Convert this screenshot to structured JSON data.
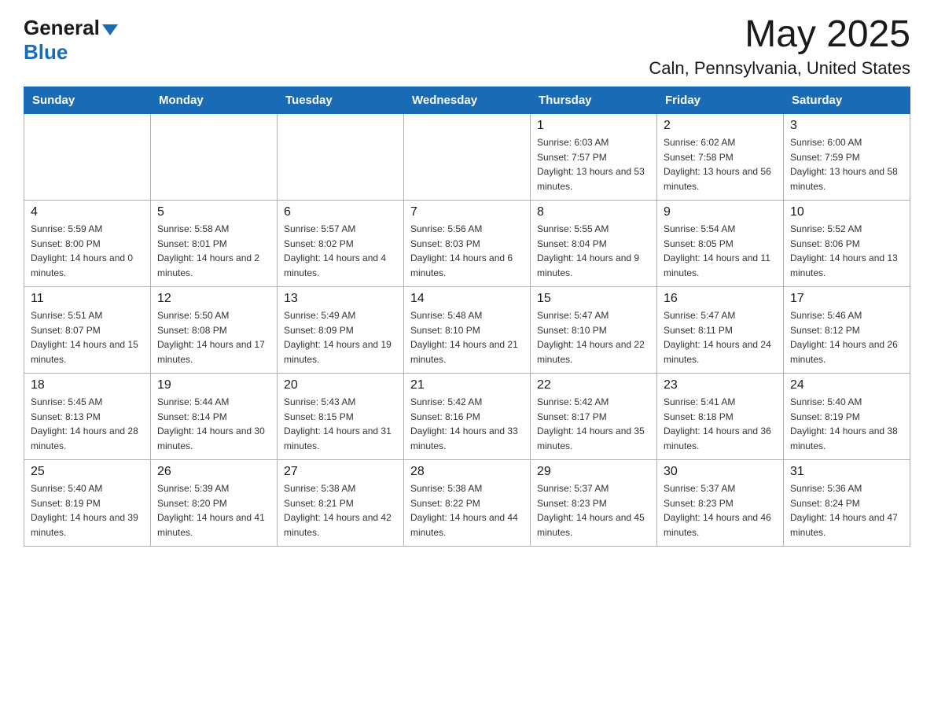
{
  "header": {
    "logo_general": "General",
    "logo_blue": "Blue",
    "month_title": "May 2025",
    "location": "Caln, Pennsylvania, United States"
  },
  "weekdays": [
    "Sunday",
    "Monday",
    "Tuesday",
    "Wednesday",
    "Thursday",
    "Friday",
    "Saturday"
  ],
  "weeks": [
    [
      {
        "day": "",
        "info": ""
      },
      {
        "day": "",
        "info": ""
      },
      {
        "day": "",
        "info": ""
      },
      {
        "day": "",
        "info": ""
      },
      {
        "day": "1",
        "info": "Sunrise: 6:03 AM\nSunset: 7:57 PM\nDaylight: 13 hours and 53 minutes."
      },
      {
        "day": "2",
        "info": "Sunrise: 6:02 AM\nSunset: 7:58 PM\nDaylight: 13 hours and 56 minutes."
      },
      {
        "day": "3",
        "info": "Sunrise: 6:00 AM\nSunset: 7:59 PM\nDaylight: 13 hours and 58 minutes."
      }
    ],
    [
      {
        "day": "4",
        "info": "Sunrise: 5:59 AM\nSunset: 8:00 PM\nDaylight: 14 hours and 0 minutes."
      },
      {
        "day": "5",
        "info": "Sunrise: 5:58 AM\nSunset: 8:01 PM\nDaylight: 14 hours and 2 minutes."
      },
      {
        "day": "6",
        "info": "Sunrise: 5:57 AM\nSunset: 8:02 PM\nDaylight: 14 hours and 4 minutes."
      },
      {
        "day": "7",
        "info": "Sunrise: 5:56 AM\nSunset: 8:03 PM\nDaylight: 14 hours and 6 minutes."
      },
      {
        "day": "8",
        "info": "Sunrise: 5:55 AM\nSunset: 8:04 PM\nDaylight: 14 hours and 9 minutes."
      },
      {
        "day": "9",
        "info": "Sunrise: 5:54 AM\nSunset: 8:05 PM\nDaylight: 14 hours and 11 minutes."
      },
      {
        "day": "10",
        "info": "Sunrise: 5:52 AM\nSunset: 8:06 PM\nDaylight: 14 hours and 13 minutes."
      }
    ],
    [
      {
        "day": "11",
        "info": "Sunrise: 5:51 AM\nSunset: 8:07 PM\nDaylight: 14 hours and 15 minutes."
      },
      {
        "day": "12",
        "info": "Sunrise: 5:50 AM\nSunset: 8:08 PM\nDaylight: 14 hours and 17 minutes."
      },
      {
        "day": "13",
        "info": "Sunrise: 5:49 AM\nSunset: 8:09 PM\nDaylight: 14 hours and 19 minutes."
      },
      {
        "day": "14",
        "info": "Sunrise: 5:48 AM\nSunset: 8:10 PM\nDaylight: 14 hours and 21 minutes."
      },
      {
        "day": "15",
        "info": "Sunrise: 5:47 AM\nSunset: 8:10 PM\nDaylight: 14 hours and 22 minutes."
      },
      {
        "day": "16",
        "info": "Sunrise: 5:47 AM\nSunset: 8:11 PM\nDaylight: 14 hours and 24 minutes."
      },
      {
        "day": "17",
        "info": "Sunrise: 5:46 AM\nSunset: 8:12 PM\nDaylight: 14 hours and 26 minutes."
      }
    ],
    [
      {
        "day": "18",
        "info": "Sunrise: 5:45 AM\nSunset: 8:13 PM\nDaylight: 14 hours and 28 minutes."
      },
      {
        "day": "19",
        "info": "Sunrise: 5:44 AM\nSunset: 8:14 PM\nDaylight: 14 hours and 30 minutes."
      },
      {
        "day": "20",
        "info": "Sunrise: 5:43 AM\nSunset: 8:15 PM\nDaylight: 14 hours and 31 minutes."
      },
      {
        "day": "21",
        "info": "Sunrise: 5:42 AM\nSunset: 8:16 PM\nDaylight: 14 hours and 33 minutes."
      },
      {
        "day": "22",
        "info": "Sunrise: 5:42 AM\nSunset: 8:17 PM\nDaylight: 14 hours and 35 minutes."
      },
      {
        "day": "23",
        "info": "Sunrise: 5:41 AM\nSunset: 8:18 PM\nDaylight: 14 hours and 36 minutes."
      },
      {
        "day": "24",
        "info": "Sunrise: 5:40 AM\nSunset: 8:19 PM\nDaylight: 14 hours and 38 minutes."
      }
    ],
    [
      {
        "day": "25",
        "info": "Sunrise: 5:40 AM\nSunset: 8:19 PM\nDaylight: 14 hours and 39 minutes."
      },
      {
        "day": "26",
        "info": "Sunrise: 5:39 AM\nSunset: 8:20 PM\nDaylight: 14 hours and 41 minutes."
      },
      {
        "day": "27",
        "info": "Sunrise: 5:38 AM\nSunset: 8:21 PM\nDaylight: 14 hours and 42 minutes."
      },
      {
        "day": "28",
        "info": "Sunrise: 5:38 AM\nSunset: 8:22 PM\nDaylight: 14 hours and 44 minutes."
      },
      {
        "day": "29",
        "info": "Sunrise: 5:37 AM\nSunset: 8:23 PM\nDaylight: 14 hours and 45 minutes."
      },
      {
        "day": "30",
        "info": "Sunrise: 5:37 AM\nSunset: 8:23 PM\nDaylight: 14 hours and 46 minutes."
      },
      {
        "day": "31",
        "info": "Sunrise: 5:36 AM\nSunset: 8:24 PM\nDaylight: 14 hours and 47 minutes."
      }
    ]
  ]
}
